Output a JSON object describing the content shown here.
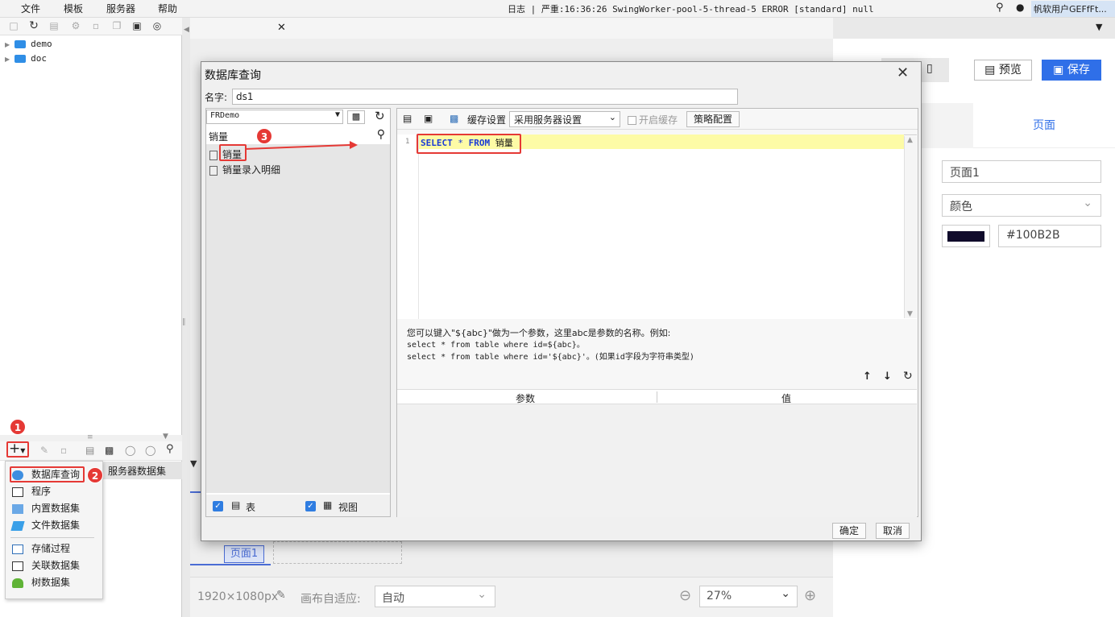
{
  "menubar": {
    "items": [
      "文件",
      "模板",
      "服务器",
      "帮助"
    ],
    "log_text": "日志 | 严重:16:36:26 SwingWorker-pool-5-thread-5 ERROR [standard] null",
    "user": "帆软用户GEFfFt..."
  },
  "tree": {
    "items": [
      "demo",
      "doc"
    ]
  },
  "datasource_menu": {
    "items": [
      "数据库查询",
      "程序",
      "内置数据集",
      "文件数据集",
      "存储过程",
      "关联数据集",
      "树数据集"
    ],
    "server_dataset": "服务器数据集"
  },
  "badges": [
    "1",
    "2",
    "3"
  ],
  "canvas": {
    "page_label": "页面1",
    "size": "1920×1080px",
    "fit_label": "画布自适应:",
    "fit_value": "自动",
    "zoom": "27%"
  },
  "right_panel": {
    "preview": "预览",
    "save": "保存",
    "tab": "页面",
    "page_name": "页面1",
    "fill_type": "颜色",
    "color_hex": "#100B2B"
  },
  "dialog": {
    "title": "数据库查询",
    "name_label": "名字:",
    "name_value": "ds1",
    "database": "FRDemo",
    "search_value": "销量",
    "tables": [
      "销量",
      "销量录入明细"
    ],
    "show_tables": "表",
    "show_views": "视图",
    "cache_label": "缓存设置",
    "cache_value": "采用服务器设置",
    "enable_cache": "开启缓存",
    "strategy": "策略配置",
    "line_no": "1",
    "sql": {
      "kw1": "SELECT",
      "star": "*",
      "kw2": "FROM",
      "table": "销量"
    },
    "hint": [
      "您可以键入\"${abc}\"做为一个参数，这里abc是参数的名称。例如:",
      "select * from table where id=${abc}。",
      "select * from table where id='${abc}'。(如果id字段为字符串类型)"
    ],
    "param_headers": [
      "参数",
      "值"
    ],
    "ok": "确定",
    "cancel": "取消"
  },
  "colors": {
    "accent": "#2f6fe8",
    "highlight": "#e53935",
    "swatch": "#100B2B"
  }
}
